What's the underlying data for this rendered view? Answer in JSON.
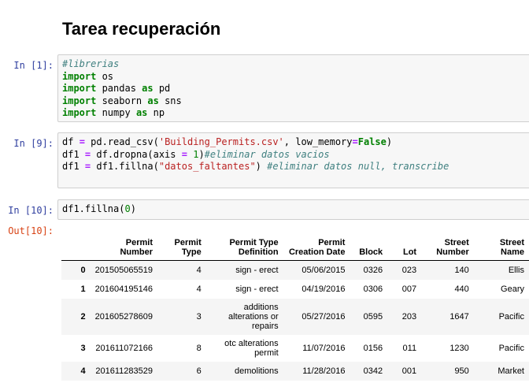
{
  "notebook": {
    "title": "Tarea recuperación",
    "cells": [
      {
        "prompt": "In [1]:"
      },
      {
        "prompt": "In [9]:"
      },
      {
        "prompt": "In [10]:",
        "out_prompt": "Out[10]:"
      }
    ]
  },
  "code": {
    "c1_l1": "#librerias",
    "c1_l2_kw": "import",
    "c1_l2_mod": " os",
    "c1_l3_kw": "import",
    "c1_l3_mod": " pandas ",
    "c1_l3_as": "as",
    "c1_l3_alias": " pd",
    "c1_l4_kw": "import",
    "c1_l4_mod": " seaborn ",
    "c1_l4_as": "as",
    "c1_l4_alias": " sns",
    "c1_l5_kw": "import",
    "c1_l5_mod": " numpy ",
    "c1_l5_as": "as",
    "c1_l5_alias": " np",
    "c2_l1_a": "df ",
    "c2_l1_eq": "=",
    "c2_l1_b": " pd.read_csv(",
    "c2_l1_str": "'Building_Permits.csv'",
    "c2_l1_c": ", low_memory",
    "c2_l1_eq2": "=",
    "c2_l1_kc": "False",
    "c2_l1_d": ")",
    "c2_l2_a": "df1 ",
    "c2_l2_eq": "=",
    "c2_l2_b": " df.dropna(axis ",
    "c2_l2_eq2": "=",
    "c2_l2_sp": " ",
    "c2_l2_num": "1",
    "c2_l2_c": ")",
    "c2_l2_cm": "#eliminar datos vacios",
    "c2_l3_a": "df1 ",
    "c2_l3_eq": "=",
    "c2_l3_b": " df1.fillna(",
    "c2_l3_str": "\"datos_faltantes\"",
    "c2_l3_c": ") ",
    "c2_l3_cm": "#eliminar datos null, transcribe",
    "c3_l1_a": "df1.fillna(",
    "c3_l1_num": "0",
    "c3_l1_b": ")"
  },
  "dataframe": {
    "columns": [
      [
        "Permit",
        "Number"
      ],
      [
        "Permit",
        "Type"
      ],
      [
        "Permit Type",
        "Definition"
      ],
      [
        "Permit",
        "Creation Date"
      ],
      [
        "Block"
      ],
      [
        "Lot"
      ],
      [
        "Street",
        "Number"
      ],
      [
        "Street",
        "Name"
      ]
    ],
    "rows": [
      {
        "index": "0",
        "cells": [
          "201505065519",
          "4",
          [
            "sign - erect"
          ],
          "05/06/2015",
          "0326",
          "023",
          "140",
          "Ellis"
        ]
      },
      {
        "index": "1",
        "cells": [
          "201604195146",
          "4",
          [
            "sign - erect"
          ],
          "04/19/2016",
          "0306",
          "007",
          "440",
          "Geary"
        ]
      },
      {
        "index": "2",
        "cells": [
          "201605278609",
          "3",
          [
            "additions",
            "alterations or",
            "repairs"
          ],
          "05/27/2016",
          "0595",
          "203",
          "1647",
          "Pacific"
        ]
      },
      {
        "index": "3",
        "cells": [
          "201611072166",
          "8",
          [
            "otc alterations",
            "permit"
          ],
          "11/07/2016",
          "0156",
          "011",
          "1230",
          "Pacific"
        ]
      },
      {
        "index": "4",
        "cells": [
          "201611283529",
          "6",
          [
            "demolitions"
          ],
          "11/28/2016",
          "0342",
          "001",
          "950",
          "Market"
        ]
      }
    ]
  }
}
